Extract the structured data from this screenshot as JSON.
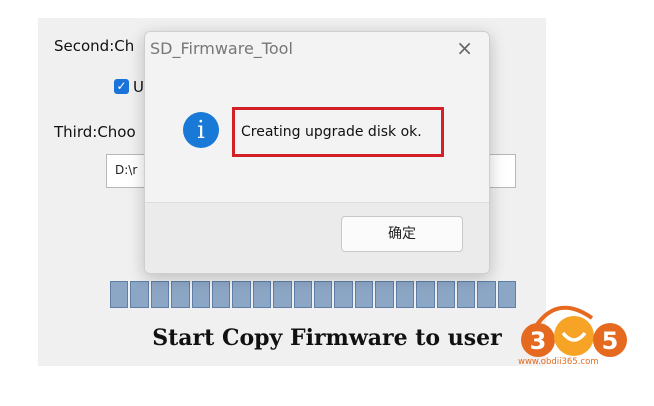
{
  "background_window": {
    "step2_label": "Second:Ch",
    "checkbox_label": "U",
    "step3_label": "Third:Choo",
    "path_value": "D:\\r",
    "progress_segments": 20,
    "status_text": "Start Copy Firmware to user"
  },
  "dialog": {
    "title": "SD_Firmware_Tool",
    "close_glyph": "×",
    "icon_glyph": "i",
    "message": "Creating upgrade disk ok.",
    "ok_label": "确定"
  },
  "watermark": {
    "logo_text": "365",
    "url": "www.obdii365.com"
  },
  "colors": {
    "highlight_border": "#d32027",
    "info_blue": "#1879d6",
    "progress_fill": "#8ca7c6",
    "logo_orange": "#e56a1f"
  }
}
